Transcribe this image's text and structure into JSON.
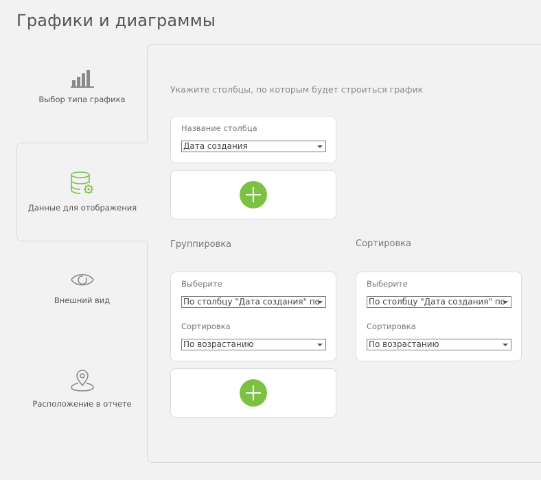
{
  "page": {
    "title": "Графики и диаграммы"
  },
  "sidebar": {
    "steps": [
      {
        "label": "Выбор типа графика",
        "icon": "bar-chart-icon"
      },
      {
        "label": "Данные для отображения",
        "icon": "database-settings-icon",
        "active": true
      },
      {
        "label": "Внешний вид",
        "icon": "eye-icon"
      },
      {
        "label": "Расположение в отчете",
        "icon": "map-pin-icon"
      }
    ]
  },
  "main": {
    "hint": "Укажите столбцы, по которым будет строиться график",
    "column": {
      "label": "Название столбца",
      "value": "Дата создания"
    },
    "grouping": {
      "title": "Группировка",
      "select_label": "Выберите",
      "select_value": "По столбцу \"Дата создания\" по",
      "sort_label": "Сортировка",
      "sort_value": "По возрастанию"
    },
    "sorting": {
      "title": "Сортировка",
      "select_label": "Выберите",
      "select_value": "По столбцу \"Дата создания\" по",
      "sort_label": "Сортировка",
      "sort_value": "По возрастанию"
    }
  },
  "colors": {
    "accent_green": "#7cc142",
    "active_icon": "#7cc142",
    "inactive_icon": "#8a8a8a"
  }
}
